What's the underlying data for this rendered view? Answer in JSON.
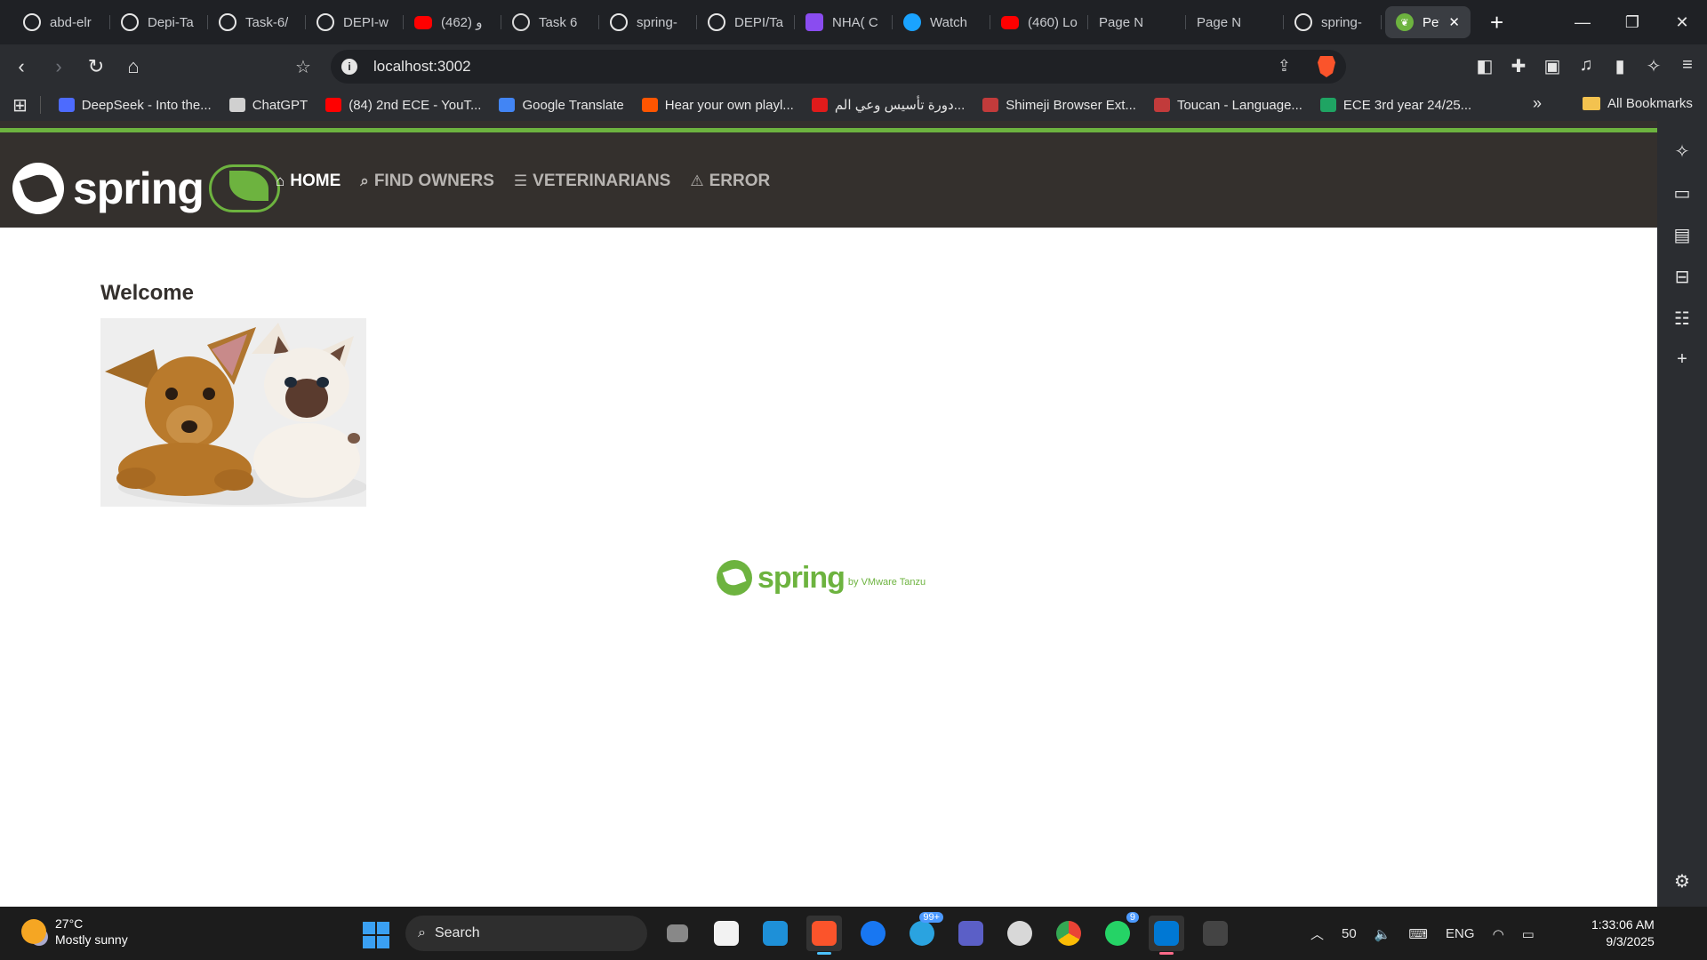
{
  "browser": {
    "tabs": [
      {
        "label": "abd-elr",
        "icon": "github-icon"
      },
      {
        "label": "Depi-Ta",
        "icon": "github-icon"
      },
      {
        "label": "Task-6/",
        "icon": "github-icon"
      },
      {
        "label": "DEPI-w",
        "icon": "github-icon"
      },
      {
        "label": "و (462)",
        "icon": "youtube-icon"
      },
      {
        "label": "Task 6",
        "icon": "chatgpt-icon"
      },
      {
        "label": "spring-",
        "icon": "github-icon"
      },
      {
        "label": "DEPI/Ta",
        "icon": "github-icon"
      },
      {
        "label": "NHA( C",
        "icon": "play-icon"
      },
      {
        "label": "Watch",
        "icon": "watch-icon"
      },
      {
        "label": "(460) Lo",
        "icon": "youtube-icon"
      },
      {
        "label": "Page N",
        "icon": "page-icon"
      },
      {
        "label": "Page N",
        "icon": "page-icon"
      },
      {
        "label": "spring-",
        "icon": "github-icon"
      }
    ],
    "active_tab": {
      "label": "Pet",
      "icon": "spring-leaf-icon"
    },
    "url": "localhost:3002",
    "bookmarks": [
      {
        "label": "DeepSeek - Into the...",
        "color": "#4d6bfe"
      },
      {
        "label": "ChatGPT",
        "color": "#d0d0d0"
      },
      {
        "label": "(84) 2nd ECE - YouT...",
        "color": "#ff0000"
      },
      {
        "label": "Google Translate",
        "color": "#4285f4"
      },
      {
        "label": "Hear your own playl...",
        "color": "#ff5500"
      },
      {
        "label": "دورة تأسيس وعي الم...",
        "color": "#e01b1b"
      },
      {
        "label": "Shimeji Browser Ext...",
        "color": "#c23b3b"
      },
      {
        "label": "Toucan - Language...",
        "color": "#c23b3b"
      },
      {
        "label": "ECE 3rd year 24/25...",
        "color": "#1fa463"
      }
    ],
    "all_bookmarks": "All Bookmarks"
  },
  "nav": {
    "items": [
      {
        "label": "HOME",
        "icon": "home-icon",
        "glyph": "⌂",
        "active": true
      },
      {
        "label": "FIND OWNERS",
        "icon": "search-icon",
        "glyph": "⌕",
        "active": false
      },
      {
        "label": "VETERINARIANS",
        "icon": "list-icon",
        "glyph": "☰",
        "active": false
      },
      {
        "label": "ERROR",
        "icon": "warning-icon",
        "glyph": "⚠",
        "active": false
      }
    ],
    "brand": "spring"
  },
  "main": {
    "title": "Welcome"
  },
  "footer": {
    "brand": "spring",
    "sub": "by VMware Tanzu"
  },
  "taskbar": {
    "temp": "27°C",
    "condition": "Mostly sunny",
    "search": "Search",
    "tray_number": "50",
    "language": "ENG",
    "time": "1:33:06 AM",
    "date": "9/3/2025",
    "telegram_badge": "99+",
    "whatsapp_badge": "9"
  },
  "colors": {
    "spring_green": "#6db33f",
    "navbar": "#34302d"
  }
}
